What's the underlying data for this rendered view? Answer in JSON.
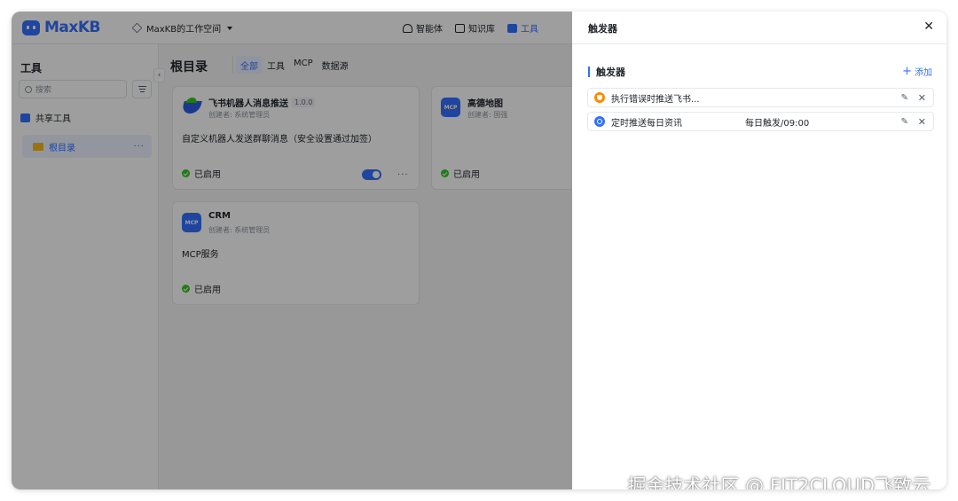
{
  "app": {
    "logo_text": "MaxKB",
    "brand_color": "#3370ff"
  },
  "header": {
    "workspace": "MaxKB的工作空间",
    "nav": [
      {
        "label": "智能体",
        "icon": "agent-icon"
      },
      {
        "label": "知识库",
        "icon": "book-icon"
      },
      {
        "label": "工具",
        "icon": "toolbox-icon",
        "active": true
      }
    ]
  },
  "sidebar": {
    "title": "工具",
    "search_placeholder": "搜索",
    "shared_label": "共享工具",
    "folder_label": "根目录",
    "folder_more": "···"
  },
  "main": {
    "title": "根目录",
    "filters": [
      "全部",
      "工具",
      "MCP",
      "数据源"
    ],
    "active_filter": "全部",
    "cards": [
      {
        "name": "飞书机器人消息推送",
        "version": "1.0.0",
        "author": "创建者: 系统管理员",
        "description": "自定义机器人发送群聊消息（安全设置通过加签）",
        "status": "已启用",
        "enabled": true,
        "more": "···"
      },
      {
        "name": "高德地图",
        "icon_text": "MCP",
        "author": "创建者: 国强",
        "status": "已启用"
      },
      {
        "name": "CRM",
        "icon_text": "MCP",
        "author": "创建者: 系统管理员",
        "description": "MCP服务",
        "status": "已启用"
      }
    ]
  },
  "drawer": {
    "title": "触发器",
    "section_title": "触发器",
    "add_label": "添加",
    "triggers": [
      {
        "name": "执行错误时推送飞书...",
        "schedule": "",
        "icon": "event-trigger-icon",
        "color": "#ff8800"
      },
      {
        "name": "定时推送每日资讯",
        "schedule": "每日触发/09:00",
        "icon": "clock-icon",
        "color": "#3370ff"
      }
    ]
  },
  "watermark": "掘金技术社区 @ FIT2CLOUD飞致云"
}
